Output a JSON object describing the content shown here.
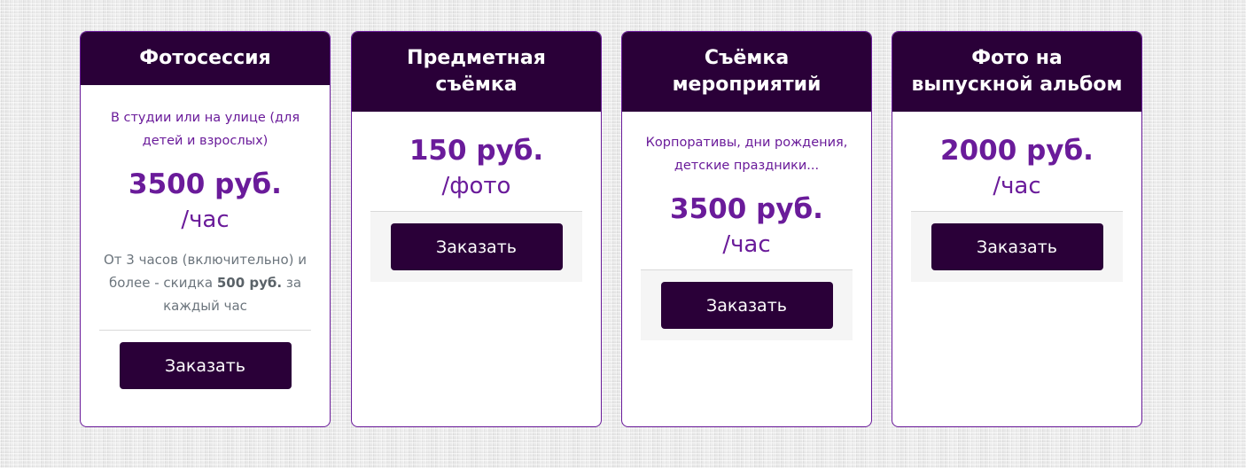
{
  "cards": [
    {
      "title": "Фотосессия",
      "description": "В студии или на улице (для детей и взрослых)",
      "price": "3500 руб.",
      "unit": "/час",
      "note_prefix": "От 3 часов (включительно) и более - скидка ",
      "note_bold": "500 руб.",
      "note_suffix": " за каждый час",
      "button": "Заказать"
    },
    {
      "title": "Предметная съёмка",
      "price": "150 руб.",
      "unit": "/фото",
      "button": "Заказать"
    },
    {
      "title": "Съёмка мероприятий",
      "description": "Корпоративы, дни рождения, детские праздники...",
      "price": "3500 руб.",
      "unit": "/час",
      "button": "Заказать"
    },
    {
      "title": "Фото на выпускной альбом",
      "price": "2000 руб.",
      "unit": "/час",
      "button": "Заказать"
    }
  ],
  "colors": {
    "header_bg": "#2a0038",
    "accent": "#6a1b9a",
    "button_bg": "#2a0038"
  }
}
